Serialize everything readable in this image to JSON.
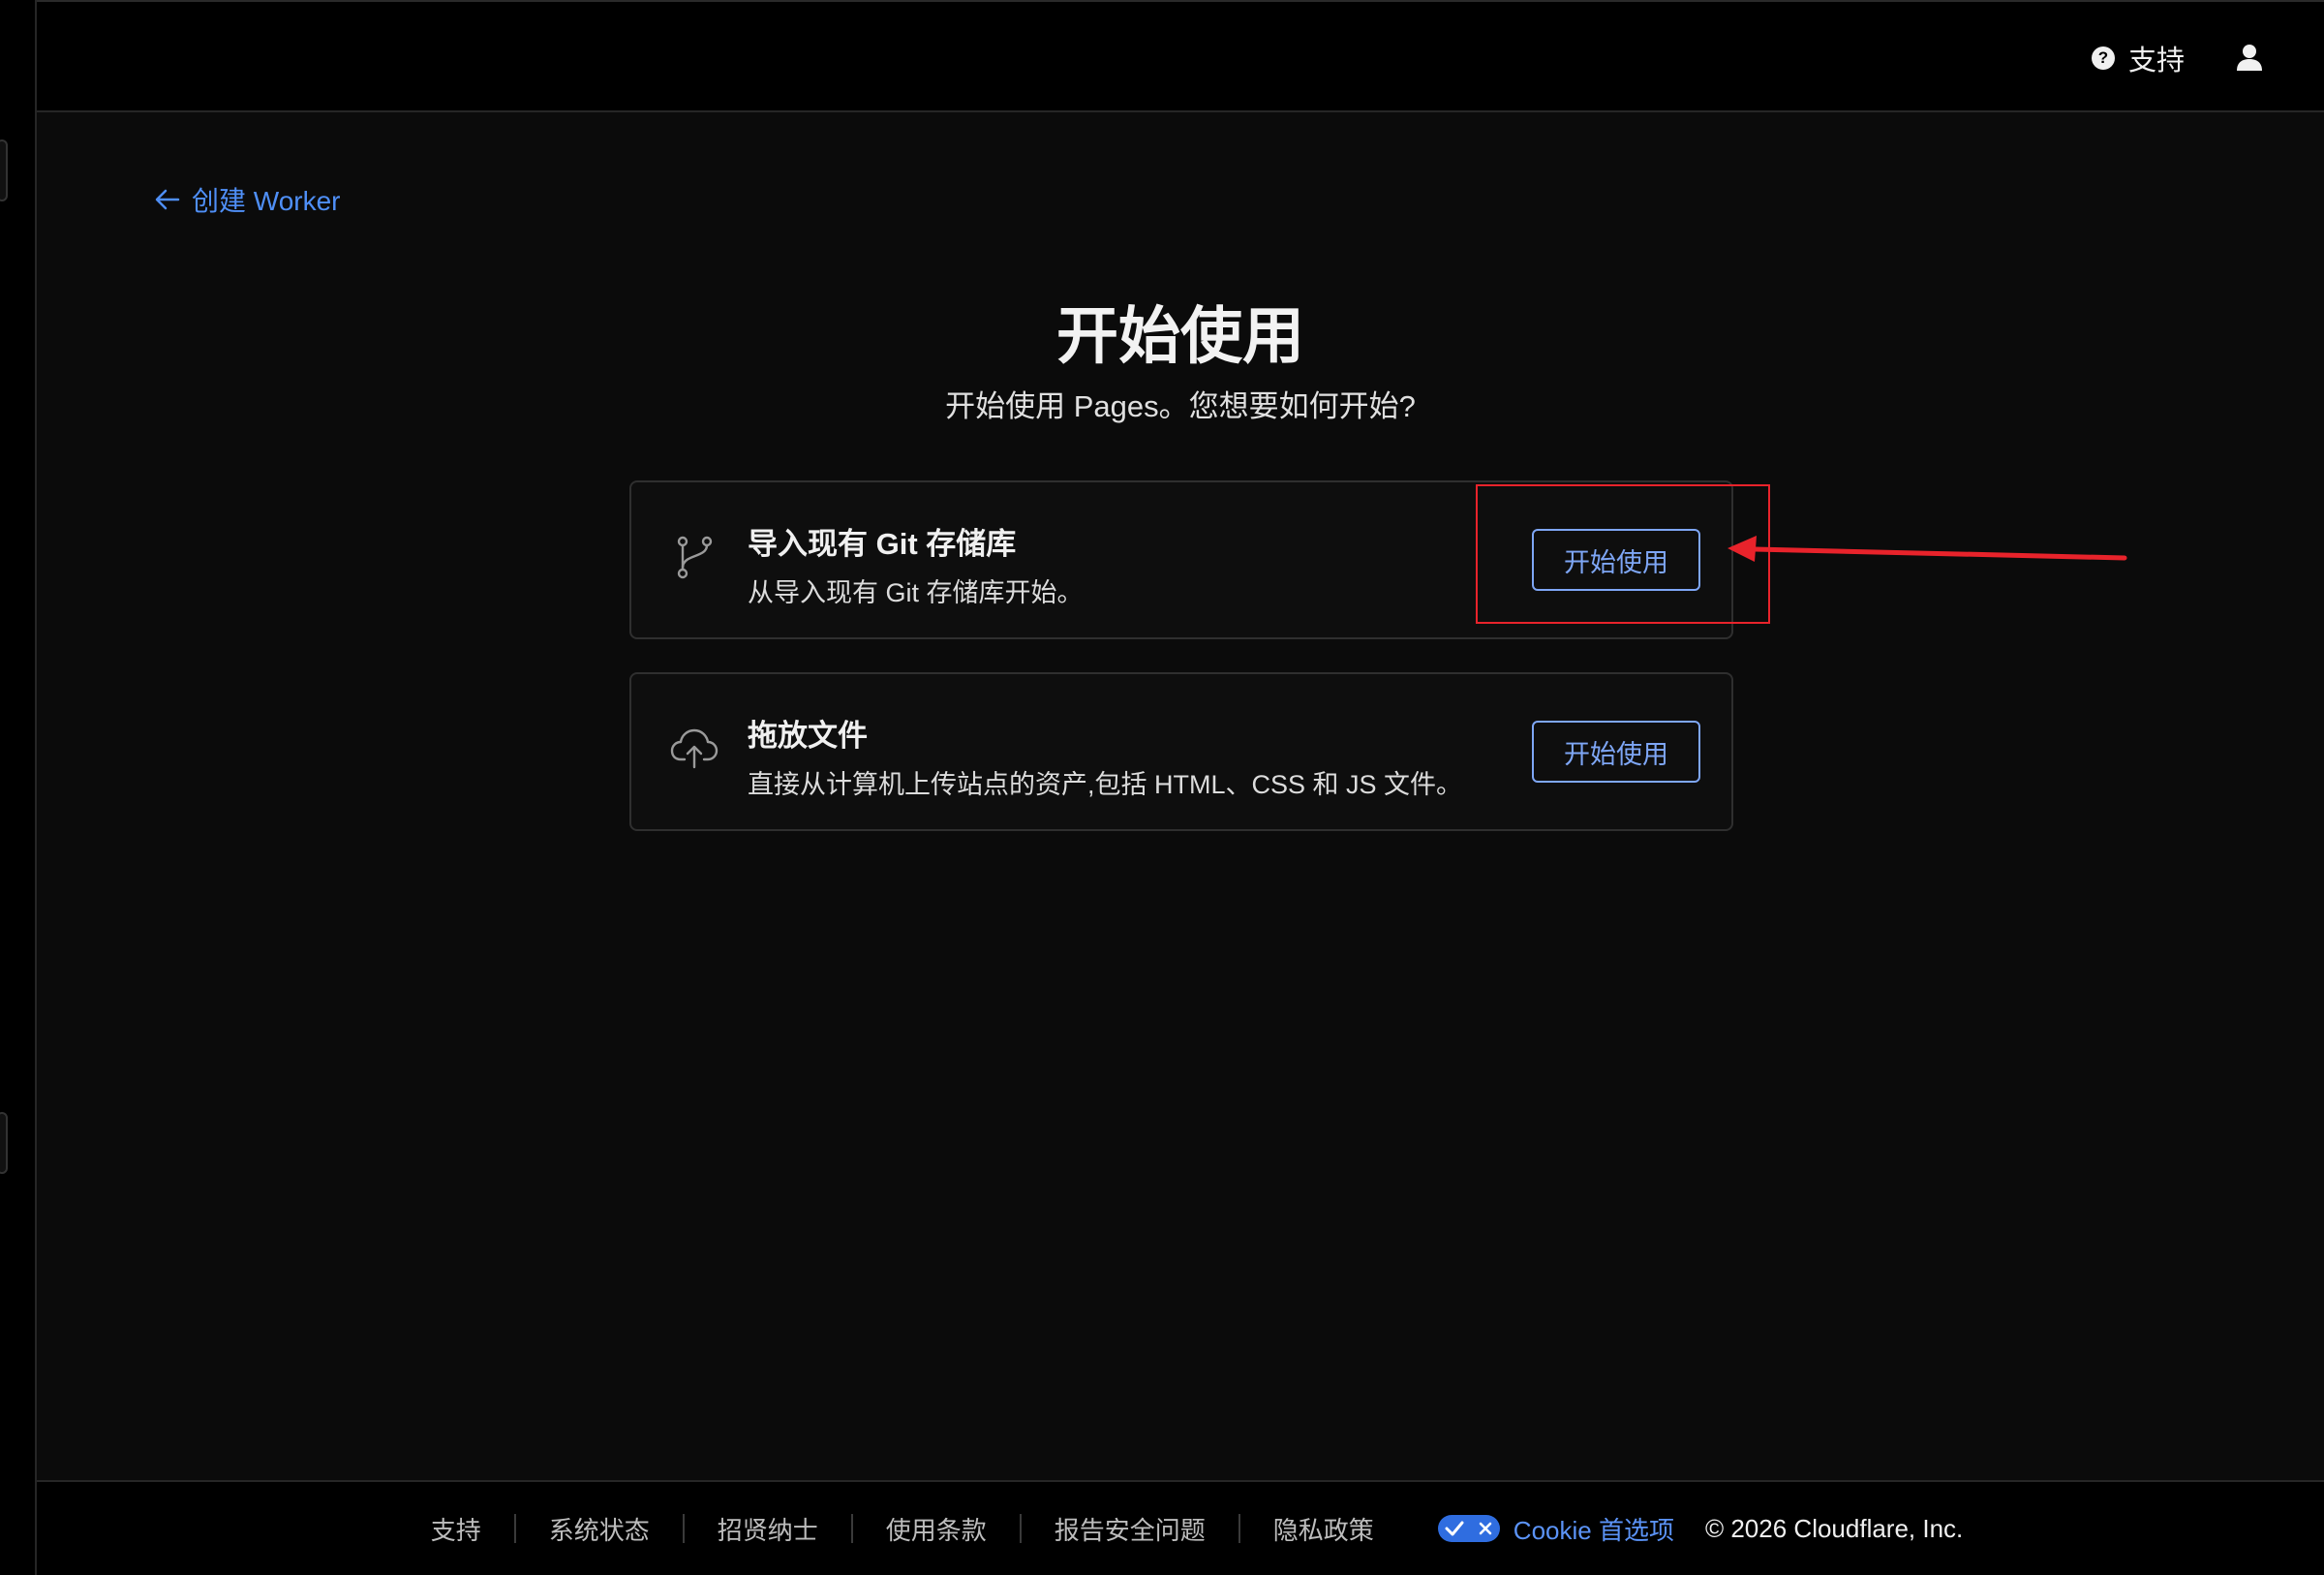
{
  "header": {
    "support_label": "支持",
    "help_icon_glyph": "?",
    "help_icon": "question-circle-icon",
    "user_icon": "user-icon"
  },
  "nav": {
    "back_label": "创建 Worker",
    "back_icon": "arrow-left-icon"
  },
  "main": {
    "title": "开始使用",
    "subtitle": "开始使用 Pages。您想要如何开始?"
  },
  "options": [
    {
      "icon": "git-branch-icon",
      "title": "导入现有 Git 存储库",
      "description": "从导入现有 Git 存储库开始。",
      "button_label": "开始使用"
    },
    {
      "icon": "cloud-upload-icon",
      "title": "拖放文件",
      "description": "直接从计算机上传站点的资产,包括 HTML、CSS 和 JS 文件。",
      "button_label": "开始使用"
    }
  ],
  "footer": {
    "links": [
      "支持",
      "系统状态",
      "招贤纳士",
      "使用条款",
      "报告安全问题",
      "隐私政策"
    ],
    "cookie_label": "Cookie 首选项",
    "copyright": "© 2026 Cloudflare, Inc."
  },
  "colors": {
    "background": "#0b0b0b",
    "accent": "#7ea6f5",
    "link": "#4f8ff7",
    "annotation": "#e8232b"
  }
}
